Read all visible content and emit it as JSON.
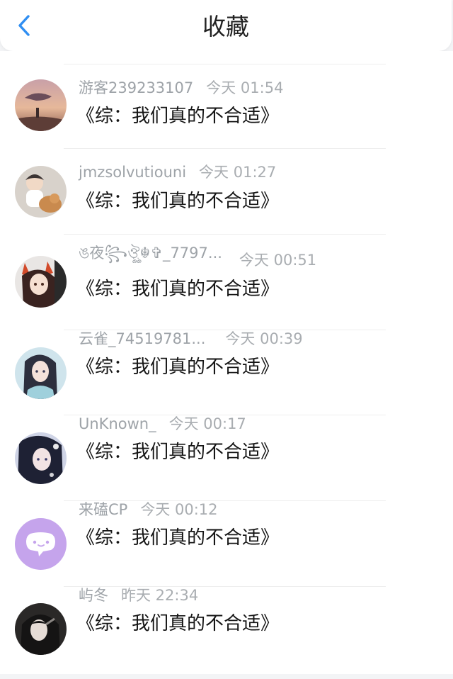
{
  "header": {
    "back_icon": "chevron-left-icon",
    "title": "收藏",
    "accent": "#2f8ef2"
  },
  "items": [
    {
      "name": "游客239233107",
      "time": "今天 01:54",
      "title": "《综：我们真的不合适》",
      "avatar": "sunset-whale-avatar"
    },
    {
      "name": "jmzsolvutiouni",
      "time": "今天 01:27",
      "title": "《综：我们真的不合适》",
      "avatar": "child-dog-avatar"
    },
    {
      "name": "ঙ夜꧂ঔৣ☬✞_7797...",
      "time": "今天 00:51",
      "title": "《综：我们真的不合适》",
      "avatar": "anime-fox-girl-avatar"
    },
    {
      "name": "云雀_74519781...",
      "time": "今天 00:39",
      "title": "《综：我们真的不合适》",
      "avatar": "anime-girl-blue-avatar"
    },
    {
      "name": "UnKnown_",
      "time": "今天 00:17",
      "title": "《综：我们真的不合适》",
      "avatar": "anime-dark-hair-avatar"
    },
    {
      "name": "来磕CP",
      "time": "今天 00:12",
      "title": "《综：我们真的不合适》",
      "avatar": "chat-bubble-avatar"
    },
    {
      "name": "屿冬",
      "time": "昨天 22:34",
      "title": "《综：我们真的不合适》",
      "avatar": "dark-portrait-avatar"
    }
  ]
}
